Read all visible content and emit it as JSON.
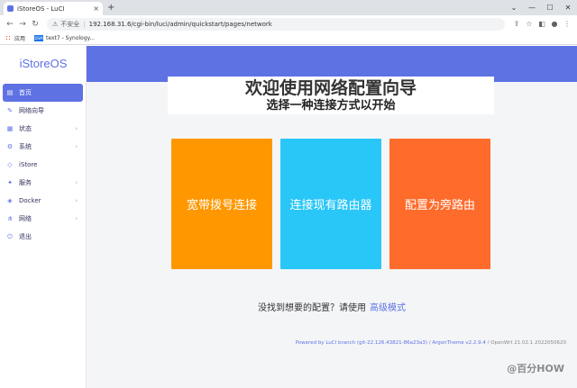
{
  "browser": {
    "tab_title": "iStoreOS - LuCI",
    "tab_close": "×",
    "new_tab": "+",
    "window_controls": [
      "⌄",
      "—",
      "☐",
      "✕"
    ],
    "insecure_label": "不安全",
    "url": "192.168.31.6/cgi-bin/luci/admin/quickstart/pages/network",
    "bookmarks": [
      {
        "label": "应用"
      },
      {
        "label": "text7 - Synology..."
      }
    ]
  },
  "sidebar": {
    "brand": "iStoreOS",
    "items": [
      {
        "label": "首页",
        "icon": "home-icon",
        "glyph": "▤",
        "active": true,
        "has_sub": false
      },
      {
        "label": "网络向导",
        "icon": "wizard-icon",
        "glyph": "✎",
        "active": false,
        "has_sub": false
      },
      {
        "label": "状态",
        "icon": "status-icon",
        "glyph": "▦",
        "active": false,
        "has_sub": true
      },
      {
        "label": "系统",
        "icon": "system-icon",
        "glyph": "⚙",
        "active": false,
        "has_sub": true
      },
      {
        "label": "iStore",
        "icon": "store-icon",
        "glyph": "◇",
        "active": false,
        "has_sub": false
      },
      {
        "label": "服务",
        "icon": "services-icon",
        "glyph": "✦",
        "active": false,
        "has_sub": true
      },
      {
        "label": "Docker",
        "icon": "docker-icon",
        "glyph": "◈",
        "active": false,
        "has_sub": true
      },
      {
        "label": "网络",
        "icon": "network-icon",
        "glyph": "⋔",
        "active": false,
        "has_sub": true
      },
      {
        "label": "退出",
        "icon": "logout-icon",
        "glyph": "⏻",
        "active": false,
        "has_sub": false
      }
    ]
  },
  "main": {
    "title": "欢迎使用网络配置向导",
    "subtitle": "选择一种连接方式以开始",
    "cards": [
      {
        "label": "宽带拨号连接",
        "color": "#ff9800"
      },
      {
        "label": "连接现有路由器",
        "color": "#29c6f8"
      },
      {
        "label": "配置为旁路由",
        "color": "#ff6b2b"
      }
    ],
    "hint_text": "没找到想要的配置？请使用",
    "hint_link": "高级模式",
    "footer_luci": "Powered by LuCI branch (git-22.126.43821-86a23a3)",
    "footer_theme": "/ ArgonTheme v2.2.9.4",
    "footer_os": "/ OpenWrt 21.02.1 2022050620"
  },
  "watermark": "@百分HOW",
  "colors": {
    "accent": "#5e72e4"
  }
}
